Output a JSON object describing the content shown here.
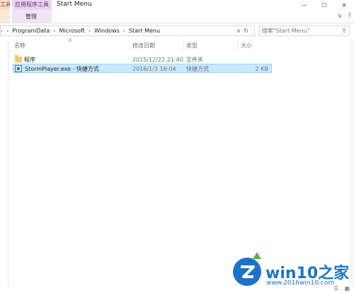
{
  "ribbon": {
    "tab_tools_left": "工具",
    "tab_app_tools": "应用程序工具",
    "manage_label": "管理",
    "window_title": "Start Menu",
    "help_glyph": "?"
  },
  "address": {
    "crumbs": [
      "ProgramData",
      "Microsoft",
      "Windows",
      "Start Menu"
    ],
    "search_placeholder": "搜索\"Start Menu\""
  },
  "columns": {
    "name": "名称",
    "date": "修改日期",
    "type": "类型",
    "size": "大小"
  },
  "files": [
    {
      "name": "程序",
      "date": "2015/12/22 21:40",
      "type": "文件夹",
      "size": "",
      "icon": "folder-icon",
      "selected": false
    },
    {
      "name": "StormPlayer.exe - 快捷方式",
      "date": "2016/1/3 16:04",
      "type": "快捷方式",
      "size": "2 KB",
      "icon": "shortcut-icon",
      "selected": true
    }
  ],
  "watermark": {
    "brand": "win10之家",
    "url": "www.2016win10.com"
  }
}
